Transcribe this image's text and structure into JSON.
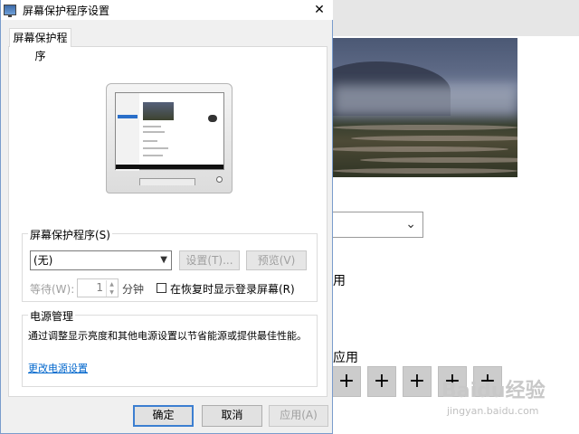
{
  "background": {
    "text_apply_1": "用",
    "text_apply_2": "应用",
    "plus_buttons": [
      "+",
      "+",
      "+",
      "+",
      "+"
    ],
    "watermark": "Baidu经验",
    "watermark_sub": "jingyan.baidu.com"
  },
  "dialog": {
    "title": "屏幕保护程序设置",
    "close_glyph": "✕",
    "tab_label": "屏幕保护程序",
    "screensaver": {
      "group_label": "屏幕保护程序(S)",
      "selected": "(无)",
      "settings_button": "设置(T)...",
      "preview_button": "预览(V)",
      "wait_label": "等待(W):",
      "wait_value": "1",
      "wait_unit": "分钟",
      "resume_checkbox_label": "在恢复时显示登录屏幕(R)",
      "resume_checked": false
    },
    "power": {
      "group_label": "电源管理",
      "description": "通过调整显示亮度和其他电源设置以节省能源或提供最佳性能。",
      "link": "更改电源设置"
    },
    "buttons": {
      "ok": "确定",
      "cancel": "取消",
      "apply": "应用(A)"
    }
  },
  "icons": {
    "dropdown": "chevron-down-icon",
    "close": "close-icon",
    "spin_up": "spin-up-icon",
    "spin_down": "spin-down-icon"
  },
  "colors": {
    "link": "#0066cc",
    "default_button_border": "#3c7fd1",
    "dialog_bg": "#f0f0f0"
  }
}
